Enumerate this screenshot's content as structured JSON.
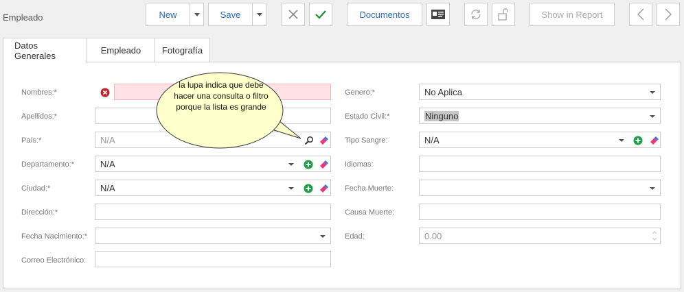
{
  "window": {
    "title": "Empleado"
  },
  "toolbar": {
    "new_label": "New",
    "save_label": "Save",
    "documentos_label": "Documentos",
    "show_report_label": "Show in Report"
  },
  "tabs": [
    {
      "label": "Datos Generales",
      "active": true
    },
    {
      "label": "Empleado",
      "active": false
    },
    {
      "label": "Fotografía",
      "active": false
    }
  ],
  "form_left": {
    "nombres": {
      "label": "Nombres:*",
      "value": ""
    },
    "apellidos": {
      "label": "Apellidos:*",
      "value": ""
    },
    "pais": {
      "label": "País:*",
      "value": "N/A"
    },
    "departamento": {
      "label": "Departamento:*",
      "value": "N/A"
    },
    "ciudad": {
      "label": "Ciudad:*",
      "value": "N/A"
    },
    "direccion": {
      "label": "Dirección:*",
      "value": ""
    },
    "fecha_nacimiento": {
      "label": "Fecha Nacimiento:*",
      "value": ""
    },
    "correo": {
      "label": "Correo Electrónico:",
      "value": ""
    }
  },
  "form_right": {
    "genero": {
      "label": "Genero:*",
      "value": "No Aplica"
    },
    "estado_civil": {
      "label": "Estado Civil:*",
      "value": "Ninguno"
    },
    "tipo_sangre": {
      "label": "Tipo Sangre:",
      "value": "N/A"
    },
    "idiomas": {
      "label": "Idiomas:",
      "value": ""
    },
    "fecha_muerte": {
      "label": "Fecha Muerte:",
      "value": ""
    },
    "causa_muerte": {
      "label": "Causa Muerte:",
      "value": ""
    },
    "edad": {
      "label": "Edad:",
      "value": "0.00"
    }
  },
  "callout": {
    "text": "la lupa indica que debe hacer una consulta o filtro porque la lista es grande"
  },
  "colors": {
    "accent": "#2a6ab8",
    "error_bg": "#fde1e4",
    "error_icon": "#c0272d",
    "add_icon": "#1e9e45",
    "callout_bg": "#ffffcc"
  },
  "icons": {
    "error": "error-x-icon",
    "search": "magnifier-icon",
    "clear": "eraser-icon",
    "add": "plus-circle-icon",
    "cancel": "x-icon",
    "accept": "check-icon",
    "refresh": "refresh-icon",
    "unlock": "unlock-icon",
    "card": "id-card-icon",
    "prev": "chevron-left-icon",
    "next": "chevron-right-icon"
  }
}
